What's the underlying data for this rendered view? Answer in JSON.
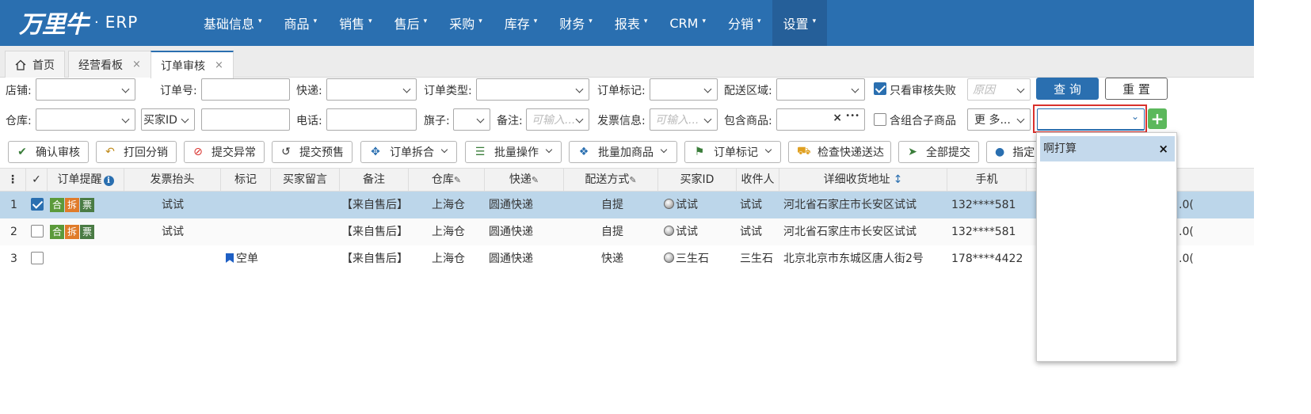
{
  "brand": {
    "logo": "万里牛",
    "dot": "·",
    "product": "ERP"
  },
  "menu": [
    {
      "label": "基础信息",
      "caret": "▾"
    },
    {
      "label": "商品",
      "caret": "▾"
    },
    {
      "label": "销售",
      "caret": "▾"
    },
    {
      "label": "售后",
      "caret": "▾"
    },
    {
      "label": "采购",
      "caret": "▾"
    },
    {
      "label": "库存",
      "caret": "▾"
    },
    {
      "label": "财务",
      "caret": "▾"
    },
    {
      "label": "报表",
      "caret": "▾"
    },
    {
      "label": "CRM",
      "caret": "▾"
    },
    {
      "label": "分销",
      "caret": "▾"
    },
    {
      "label": "设置",
      "caret": "▾"
    }
  ],
  "tabs": [
    {
      "label": "首页"
    },
    {
      "label": "经营看板",
      "close": "×"
    },
    {
      "label": "订单审核",
      "close": "×"
    }
  ],
  "filters": {
    "shop": "店铺:",
    "order_no": "订单号:",
    "express": "快递:",
    "order_type": "订单类型:",
    "order_mark": "订单标记:",
    "region": "配送区域:",
    "only_failed": "只看审核失败",
    "reason_ph": "原因",
    "query": "查 询",
    "reset": "重 置",
    "warehouse": "仓库:",
    "buyer_id": "买家ID",
    "phone": "电话:",
    "flag": "旗子:",
    "remark": "备注:",
    "remark_ph": "可输入...",
    "invoice": "发票信息:",
    "invoice_ph": "可输入...",
    "contains_goods": "包含商品:",
    "clear": "×",
    "more_dots": "•••",
    "combo": "含组合子商品",
    "more": "更 多...",
    "add": "+"
  },
  "toolbar": [
    {
      "icon": "✔",
      "label": "确认审核"
    },
    {
      "icon": "↶",
      "label": "打回分销"
    },
    {
      "icon": "⊘",
      "label": "提交异常"
    },
    {
      "icon": "↺",
      "label": "提交预售"
    },
    {
      "icon": "✥",
      "label": "订单拆合"
    },
    {
      "icon": "☰",
      "label": "批量操作"
    },
    {
      "icon": "❖",
      "label": "批量加商品"
    },
    {
      "icon": "⚑",
      "label": "订单标记"
    },
    {
      "icon": "⛟",
      "label": "检查快递送达"
    },
    {
      "icon": "➤",
      "label": "全部提交"
    },
    {
      "icon": "●",
      "label": "指定"
    }
  ],
  "table": {
    "headers": {
      "menu": "⋮",
      "check": "✓",
      "reminder": "订单提醒",
      "info": "i",
      "invoice_title": "发票抬头",
      "mark": "标记",
      "buyer_msg": "买家留言",
      "remark": "备注",
      "warehouse": "仓库",
      "express": "快递",
      "delivery": "配送方式",
      "buyer_id": "买家ID",
      "receiver": "收件人",
      "address": "详细收货地址",
      "sort": "↕",
      "mobile": "手机"
    },
    "rows": [
      {
        "no": "1",
        "checked": true,
        "badges": [
          "合",
          "拆",
          "票"
        ],
        "invoice": "试试",
        "mark": "",
        "remark": "【来自售后】",
        "warehouse": "上海仓",
        "express": "圆通快递",
        "delivery": "自提",
        "buyer_id": "试试",
        "receiver": "试试",
        "address": "河北省石家庄市长安区试试",
        "mobile": "132****581",
        "tail": ".0("
      },
      {
        "no": "2",
        "checked": false,
        "badges": [
          "合",
          "拆",
          "票"
        ],
        "invoice": "试试",
        "mark": "",
        "remark": "【来自售后】",
        "warehouse": "上海仓",
        "express": "圆通快递",
        "delivery": "自提",
        "buyer_id": "试试",
        "receiver": "试试",
        "address": "河北省石家庄市长安区试试",
        "mobile": "132****581",
        "tail": ".0("
      },
      {
        "no": "3",
        "checked": false,
        "badges": [],
        "invoice": "",
        "mark": "空单",
        "remark": "【来自售后】",
        "warehouse": "上海仓",
        "express": "圆通快递",
        "delivery": "快递",
        "buyer_id": "三生石",
        "receiver": "三生石",
        "address": "北京北京市东城区唐人街2号",
        "mobile": "178****4422",
        "tail": ".0("
      }
    ]
  },
  "dropdown": {
    "option": "啊打算",
    "close": "×"
  },
  "colors": {
    "brand": "#2a6fb0",
    "selected_row": "#bcd6ea",
    "highlight_border": "#d9312d",
    "add_green": "#5cb85c"
  }
}
